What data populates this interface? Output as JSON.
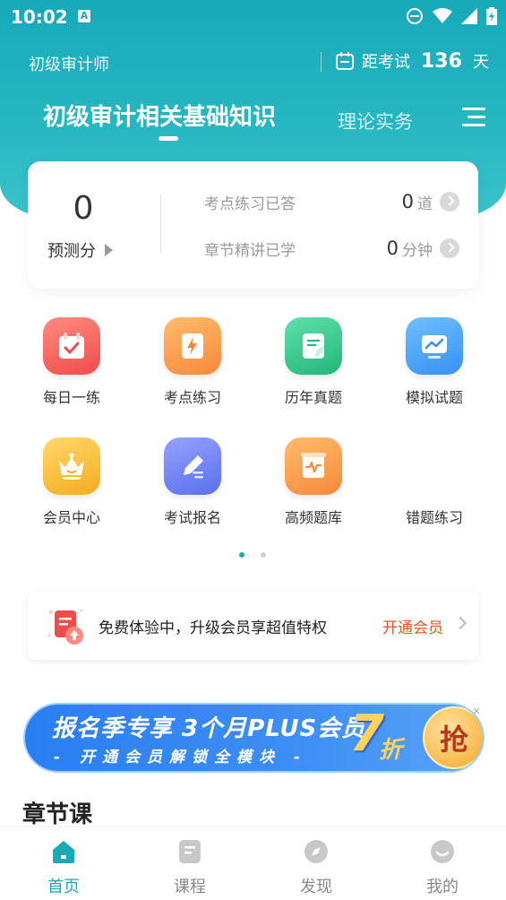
{
  "status_bar": {
    "time": "10:02",
    "notification_badge": "A"
  },
  "header": {
    "exam_name": "初级审计师",
    "countdown_label": "距考试",
    "countdown_days": "136",
    "countdown_unit": "天"
  },
  "tabs": [
    {
      "label": "初级审计相关基础知识",
      "active": true
    },
    {
      "label": "理论实务",
      "active": false
    }
  ],
  "score_card": {
    "predicted_score": "0",
    "predicted_label": "预测分",
    "stats": [
      {
        "label": "考点练习已答",
        "value": "0",
        "unit": "道"
      },
      {
        "label": "章节精讲已学",
        "value": "0",
        "unit": "分钟"
      }
    ]
  },
  "features": [
    {
      "label": "每日一练",
      "icon": "calendar-check-icon",
      "color": "#f25b5b"
    },
    {
      "label": "考点练习",
      "icon": "lightning-doc-icon",
      "color": "#f7963a"
    },
    {
      "label": "历年真题",
      "icon": "leaf-doc-icon",
      "color": "#2ec48a"
    },
    {
      "label": "模拟试题",
      "icon": "monitor-chart-icon",
      "color": "#3d9cf5"
    },
    {
      "label": "会员中心",
      "icon": "crown-icon",
      "color": "#f5b82e"
    },
    {
      "label": "考试报名",
      "icon": "pen-paper-icon",
      "color": "#6c7ff2"
    },
    {
      "label": "高频题库",
      "icon": "scroll-pulse-icon",
      "color": "#f7963a"
    },
    {
      "label": "错题练习",
      "icon": "",
      "color": ""
    }
  ],
  "pager": {
    "count": 2,
    "active": 0
  },
  "vip_promo": {
    "text": "免费体验中，升级会员享超值特权",
    "link": "开通会员"
  },
  "banner": {
    "line1": "报名季专享 3个月PLUS会员",
    "line2": "- 开通会员解锁全模块 -",
    "discount": "7",
    "discount_unit": "折",
    "grab": "抢",
    "close": "×"
  },
  "section": {
    "title": "章节课"
  },
  "bottom_nav": [
    {
      "label": "首页",
      "icon": "home-icon",
      "active": true
    },
    {
      "label": "课程",
      "icon": "course-icon",
      "active": false
    },
    {
      "label": "发现",
      "icon": "compass-icon",
      "active": false
    },
    {
      "label": "我的",
      "icon": "smile-icon",
      "active": false
    }
  ],
  "colors": {
    "primary": "#1aa9b6",
    "accent": "#e8542d"
  }
}
